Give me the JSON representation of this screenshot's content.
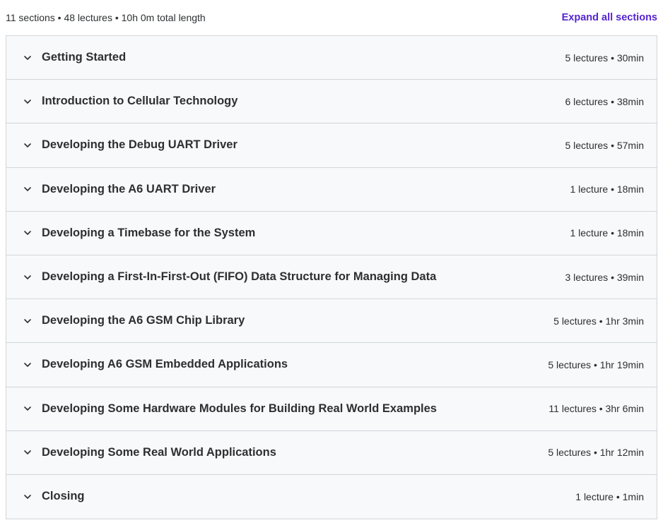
{
  "summary": {
    "text": "11 sections • 48 lectures • 10h 0m total length",
    "expand_label": "Expand all sections"
  },
  "colors": {
    "accent": "#5624d0",
    "row_background": "#f7f9fa",
    "border": "#d1d7dc",
    "text": "#2d2f31"
  },
  "icons": {
    "section_toggle": "chevron-down-icon"
  },
  "sections": [
    {
      "title": "Getting Started",
      "meta": "5 lectures • 30min"
    },
    {
      "title": "Introduction to Cellular Technology",
      "meta": "6 lectures • 38min"
    },
    {
      "title": "Developing the Debug UART Driver",
      "meta": "5 lectures • 57min"
    },
    {
      "title": "Developing the A6 UART Driver",
      "meta": "1 lecture • 18min"
    },
    {
      "title": "Developing a Timebase for the System",
      "meta": "1 lecture • 18min"
    },
    {
      "title": "Developing a First-In-First-Out (FIFO) Data Structure for Managing Data",
      "meta": "3 lectures • 39min"
    },
    {
      "title": "Developing the A6 GSM Chip Library",
      "meta": "5 lectures • 1hr 3min"
    },
    {
      "title": "Developing A6 GSM Embedded Applications",
      "meta": "5 lectures • 1hr 19min"
    },
    {
      "title": "Developing Some Hardware Modules for Building Real World Examples",
      "meta": "11 lectures • 3hr 6min"
    },
    {
      "title": "Developing Some Real World Applications",
      "meta": "5 lectures • 1hr 12min"
    },
    {
      "title": "Closing",
      "meta": "1 lecture • 1min"
    }
  ]
}
